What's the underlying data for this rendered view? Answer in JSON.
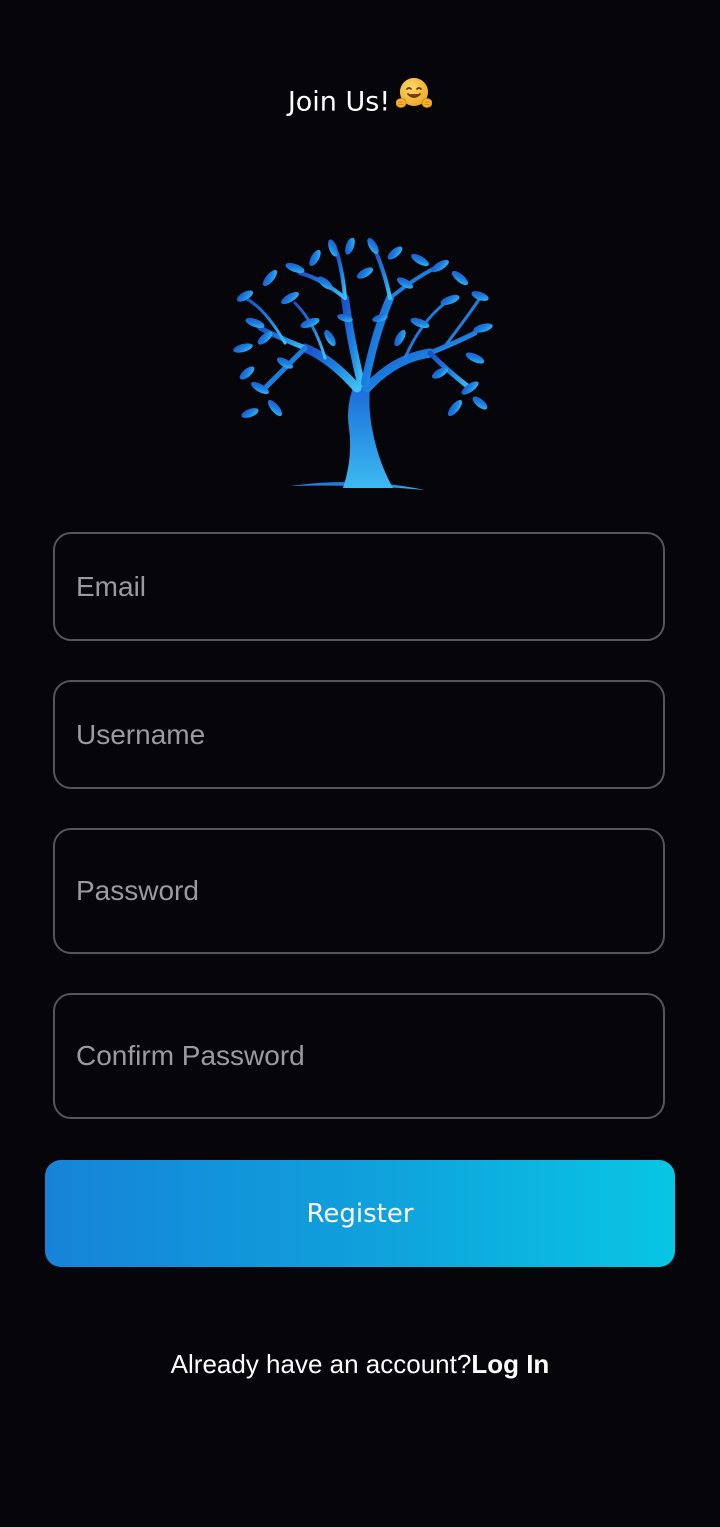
{
  "header": {
    "title": "Join Us!",
    "emoji_icon": "hugging-face-emoji"
  },
  "logo": {
    "icon": "tree-logo-icon",
    "colors": [
      "#1e5fd4",
      "#1fa3e8",
      "#3ab8f0"
    ]
  },
  "form": {
    "email": {
      "placeholder": "Email",
      "value": ""
    },
    "username": {
      "placeholder": "Username",
      "value": ""
    },
    "password": {
      "placeholder": "Password",
      "value": ""
    },
    "confirm_password": {
      "placeholder": "Confirm Password",
      "value": ""
    }
  },
  "register_button": {
    "label": "Register",
    "gradient": [
      "#1683d8",
      "#08c6e4"
    ]
  },
  "footer": {
    "prompt": "Already have an account?",
    "login_link": "Log In"
  },
  "theme": {
    "background": "#05050a",
    "field_border": "#55555b",
    "placeholder_color": "#9a9aa0"
  }
}
